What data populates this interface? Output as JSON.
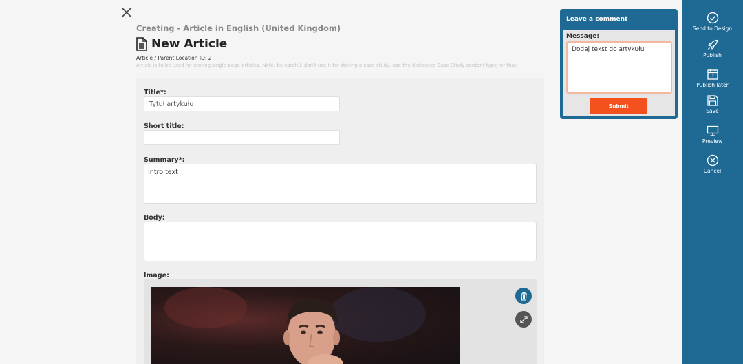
{
  "header": {
    "breadcrumb": "Creating - Article in English (United Kingdom)",
    "title": "New Article",
    "parent_location": "Article / Parent Location ID: 2",
    "description": "Article is to be used for storing single-page articles. Note: be careful, don't use it for storing a case study, use the dedicated Case Study content type for that."
  },
  "form": {
    "title_label": "Title*:",
    "title_value": "Tytuł artykułu",
    "short_title_label": "Short title:",
    "short_title_value": "",
    "summary_label": "Summary*:",
    "summary_value": "Intro text",
    "body_label": "Body:",
    "body_value": "",
    "image_label": "Image:"
  },
  "comment": {
    "heading": "Leave a comment",
    "message_label": "Message:",
    "message_value": "Dodaj tekst do artykułu",
    "submit_label": "Submit"
  },
  "sidebar": {
    "items": [
      {
        "label": "Send to Design",
        "icon": "check-circle-icon"
      },
      {
        "label": "Publish",
        "icon": "rocket-icon"
      },
      {
        "label": "Publish later",
        "icon": "calendar-icon"
      },
      {
        "label": "Save",
        "icon": "save-icon"
      },
      {
        "label": "Preview",
        "icon": "monitor-icon"
      },
      {
        "label": "Cancel",
        "icon": "cancel-icon"
      }
    ]
  },
  "colors": {
    "sidebar_bg": "#1e6a95",
    "submit_bg": "#f4511e",
    "image_delete_btn": "#1e6a95",
    "image_expand_btn": "#555555"
  }
}
